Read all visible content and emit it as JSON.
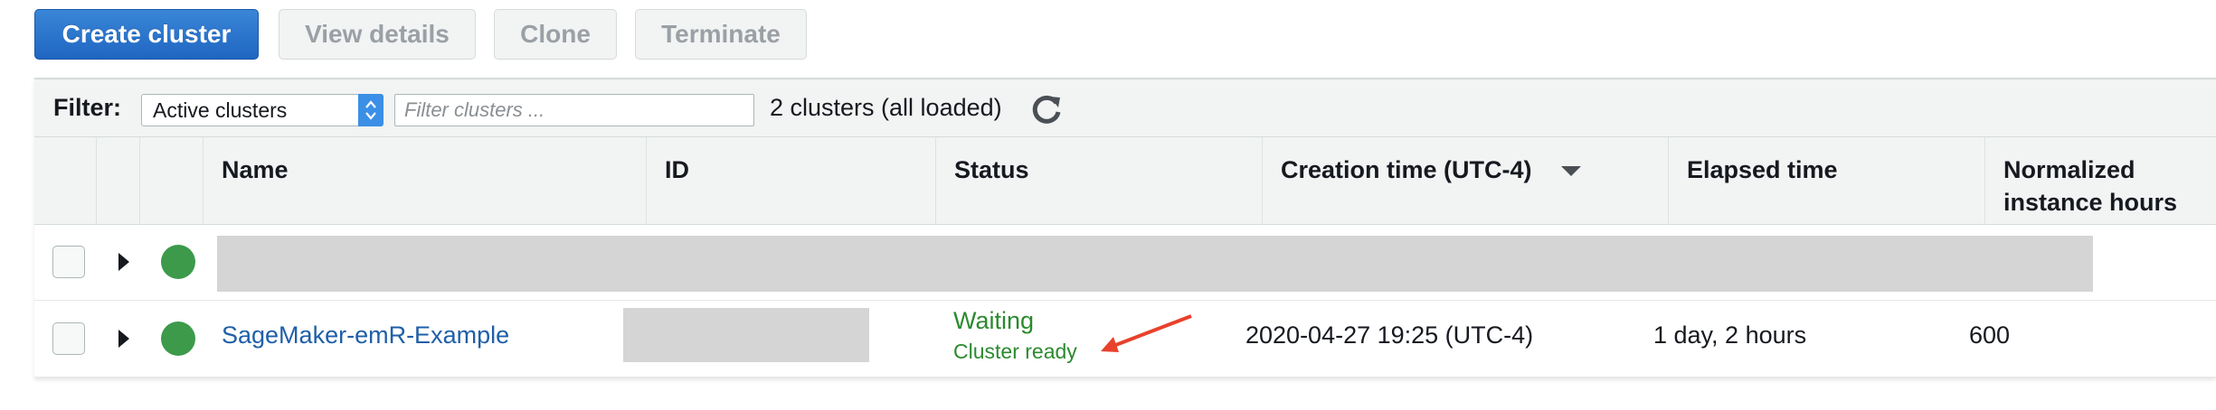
{
  "toolbar": {
    "create_label": "Create cluster",
    "view_details_label": "View details",
    "clone_label": "Clone",
    "terminate_label": "Terminate"
  },
  "filter": {
    "label": "Filter:",
    "select_value": "Active clusters",
    "input_placeholder": "Filter clusters ...",
    "count_text": "2 clusters (all loaded)"
  },
  "table": {
    "columns": {
      "name": "Name",
      "id": "ID",
      "status": "Status",
      "creation_time": "Creation time (UTC-4)",
      "elapsed_time": "Elapsed time",
      "normalized_hours": "Normalized instance hours"
    },
    "rows": [
      {
        "status_color": "#3c9a4a",
        "redacted": true
      },
      {
        "status_color": "#3c9a4a",
        "name": "SageMaker-emR-Example",
        "status": "Waiting",
        "status_detail": "Cluster ready",
        "creation_time": "2020-04-27 19:25 (UTC-4)",
        "elapsed_time": "1 day, 2 hours",
        "normalized_hours": "600"
      }
    ]
  },
  "icons": {
    "refresh": "refresh-icon",
    "sort": "sort-descending-icon",
    "expand": "expand-caret-icon",
    "annotation": "red-arrow-annotation"
  },
  "colors": {
    "primary_button": "#1f66c1",
    "link": "#1f5fa8",
    "status_green": "#2b8a2e",
    "annotation_arrow": "#e8412c"
  }
}
